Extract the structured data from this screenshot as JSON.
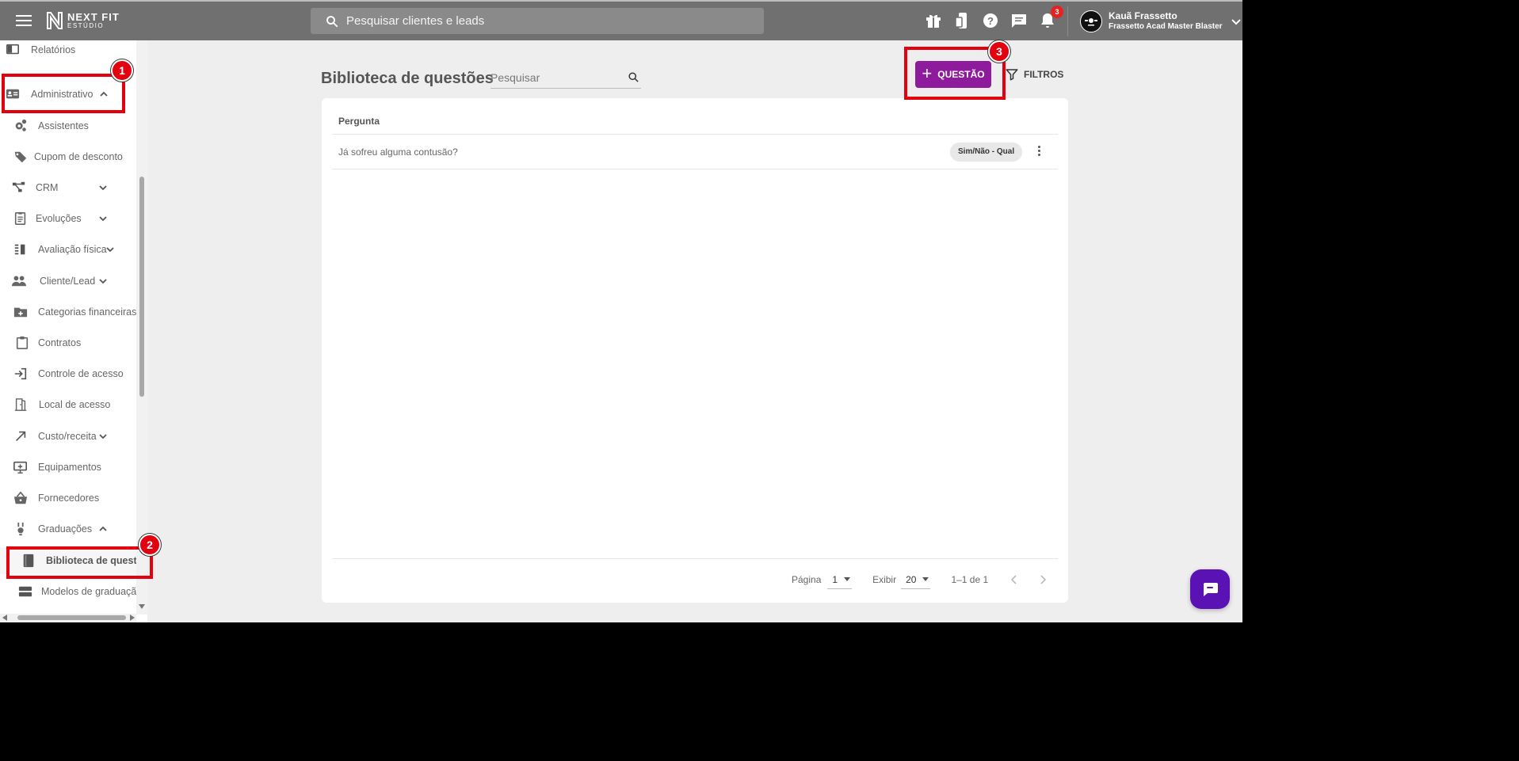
{
  "topbar": {
    "logo_line1": "NEXT FIT",
    "logo_line2": "ESTÚDIO",
    "search_placeholder": "Pesquisar clientes e leads",
    "notification_count": "3",
    "user_name": "Kauã Frassetto",
    "user_org": "Frassetto Acad Master Blaster"
  },
  "sidebar": {
    "items": [
      {
        "label": "Relatórios",
        "icon": "reports-icon"
      },
      {
        "label": "Administrativo",
        "icon": "id-card-icon",
        "chevron": "up"
      },
      {
        "label": "Assistentes",
        "icon": "gear-icon"
      },
      {
        "label": "Cupom de desconto",
        "icon": "tag-icon"
      },
      {
        "label": "CRM",
        "icon": "crm-icon",
        "chevron": "down"
      },
      {
        "label": "Evoluções",
        "icon": "clipboard-list-icon",
        "chevron": "down"
      },
      {
        "label": "Avaliação física",
        "icon": "assessment-icon",
        "chevron": "down"
      },
      {
        "label": "Cliente/Lead",
        "icon": "people-icon",
        "chevron": "down"
      },
      {
        "label": "Categorias financeiras",
        "icon": "folder-plus-icon"
      },
      {
        "label": "Contratos",
        "icon": "clipboard-icon"
      },
      {
        "label": "Controle de acesso",
        "icon": "login-icon"
      },
      {
        "label": "Local de acesso",
        "icon": "door-icon"
      },
      {
        "label": "Custo/receita",
        "icon": "arrow-up-right-icon",
        "chevron": "down"
      },
      {
        "label": "Equipamentos",
        "icon": "monitor-icon"
      },
      {
        "label": "Fornecedores",
        "icon": "basket-icon"
      },
      {
        "label": "Graduações",
        "icon": "medal-icon",
        "chevron": "up"
      },
      {
        "label": "Biblioteca de questões",
        "icon": "book-icon",
        "active": true
      },
      {
        "label": "Modelos de graduação",
        "icon": "layers-icon"
      }
    ]
  },
  "annotations": {
    "step1": "1",
    "step2": "2",
    "step3": "3"
  },
  "main": {
    "title": "Biblioteca de questões",
    "search_placeholder": "Pesquisar",
    "add_button": "QUESTÃO",
    "filter_button": "FILTROS",
    "table": {
      "header": "Pergunta",
      "rows": [
        {
          "question": "Já sofreu alguma contusão?",
          "type": "Sim/Não - Qual"
        }
      ]
    },
    "pagination": {
      "page_label": "Página",
      "page_value": "1",
      "show_label": "Exibir",
      "show_value": "20",
      "range": "1–1 de 1"
    }
  },
  "colors": {
    "accent": "#8e1b9c",
    "annotation": "#e3000f",
    "chat": "#5b12b5"
  }
}
